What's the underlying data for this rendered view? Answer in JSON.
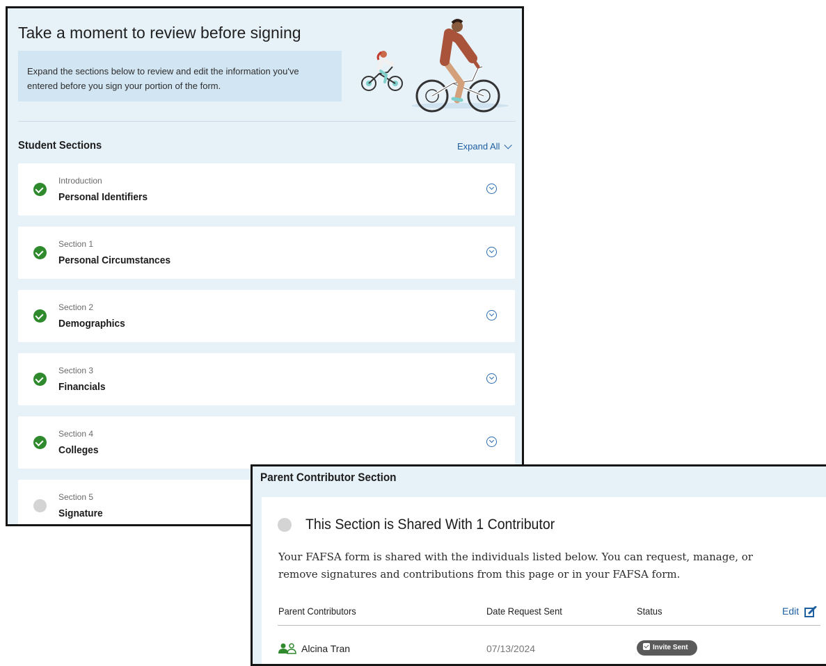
{
  "student_panel": {
    "title": "Take a moment to review before signing",
    "intro_line1": "Expand the sections below to review and edit the information you've",
    "intro_line2": "entered before you sign your portion of the form.",
    "sections_heading": "Student Sections",
    "expand_all_label": "Expand All",
    "sections": [
      {
        "label": "Introduction",
        "name": "Personal Identifiers",
        "status": "complete"
      },
      {
        "label": "Section 1",
        "name": "Personal Circumstances",
        "status": "complete"
      },
      {
        "label": "Section 2",
        "name": "Demographics",
        "status": "complete"
      },
      {
        "label": "Section 3",
        "name": "Financials",
        "status": "complete"
      },
      {
        "label": "Section 4",
        "name": "Colleges",
        "status": "complete"
      },
      {
        "label": "Section 5",
        "name": "Signature",
        "status": "incomplete"
      }
    ]
  },
  "parent_panel": {
    "heading": "Parent Contributor Section",
    "shared_title": "This Section is Shared With 1 Contributor",
    "description_line1": "Your FAFSA form is shared with the individuals listed below. You can request, manage, or",
    "description_line2": "remove signatures and contributions from this page or in your FAFSA form.",
    "columns": [
      "Parent Contributors",
      "Date Request Sent",
      "Status"
    ],
    "edit_label": "Edit",
    "contributors": [
      {
        "name": "Alcina Tran",
        "date": "07/13/2024",
        "status": "Invite Sent"
      }
    ]
  },
  "colors": {
    "panel_bg": "#e7f1f8",
    "complete_green": "#2f8a2d",
    "link_blue": "#1e5fa0",
    "badge_gray": "#5a5a5a"
  }
}
